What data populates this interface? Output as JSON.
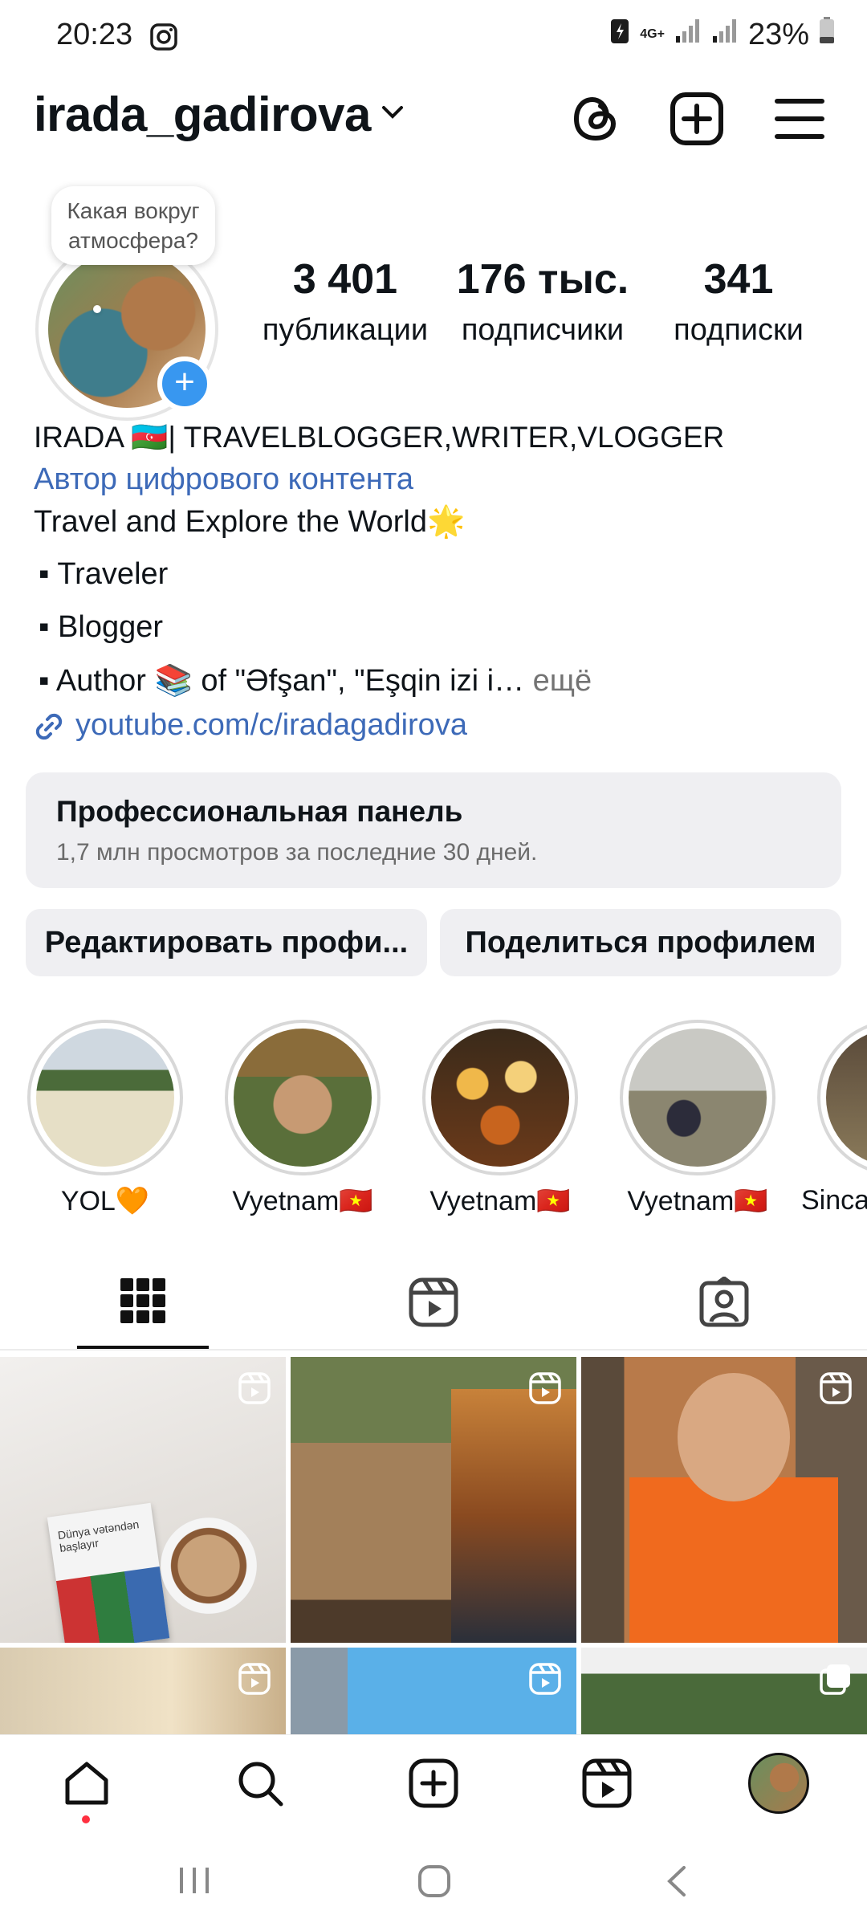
{
  "status_bar": {
    "time": "20:23",
    "battery": "23%",
    "network": "4G+"
  },
  "header": {
    "username": "irada_gadirova"
  },
  "profile": {
    "note": "Какая вокруг атмосфера?",
    "stats": [
      {
        "value": "3 401",
        "label": "публикации"
      },
      {
        "value": "176 тыс.",
        "label": "подписчики"
      },
      {
        "value": "341",
        "label": "подписки"
      }
    ],
    "name_line": "IRADA 🇦🇿| TRAVELBLOGGER,WRITER,VLOGGER",
    "category": "Автор цифрового контента",
    "bio_line1": "Travel and Explore the World🌟",
    "bio_bullets": [
      "▪ Traveler",
      "▪ Blogger",
      "▪ Author 📚 of \"Əfşan\", \"Eşqin izi i…"
    ],
    "more": " ещё",
    "link": "youtube.com/c/iradagadirova"
  },
  "pro_panel": {
    "title": "Профессиональная панель",
    "subtitle": "1,7 млн просмотров за последние 30 дней."
  },
  "buttons": {
    "edit": "Редактировать профи...",
    "share": "Поделиться профилем"
  },
  "highlights": [
    {
      "label": "YOL🧡"
    },
    {
      "label": "Vyetnam🇻🇳"
    },
    {
      "label": "Vyetnam🇻🇳"
    },
    {
      "label": "Vyetnam🇻🇳"
    },
    {
      "label": "Sinca"
    }
  ],
  "tabs": [
    "grid",
    "reels",
    "tagged"
  ],
  "grid_posts": [
    {
      "type": "reel",
      "book_title": "Dünya vətəndən başlayır"
    },
    {
      "type": "reel"
    },
    {
      "type": "reel"
    },
    {
      "type": "reel"
    },
    {
      "type": "reel"
    },
    {
      "type": "carousel"
    }
  ],
  "colors": {
    "link_blue": "#3d6ab8",
    "badge_blue": "#3897f0",
    "panel_bg": "#efeff2"
  }
}
